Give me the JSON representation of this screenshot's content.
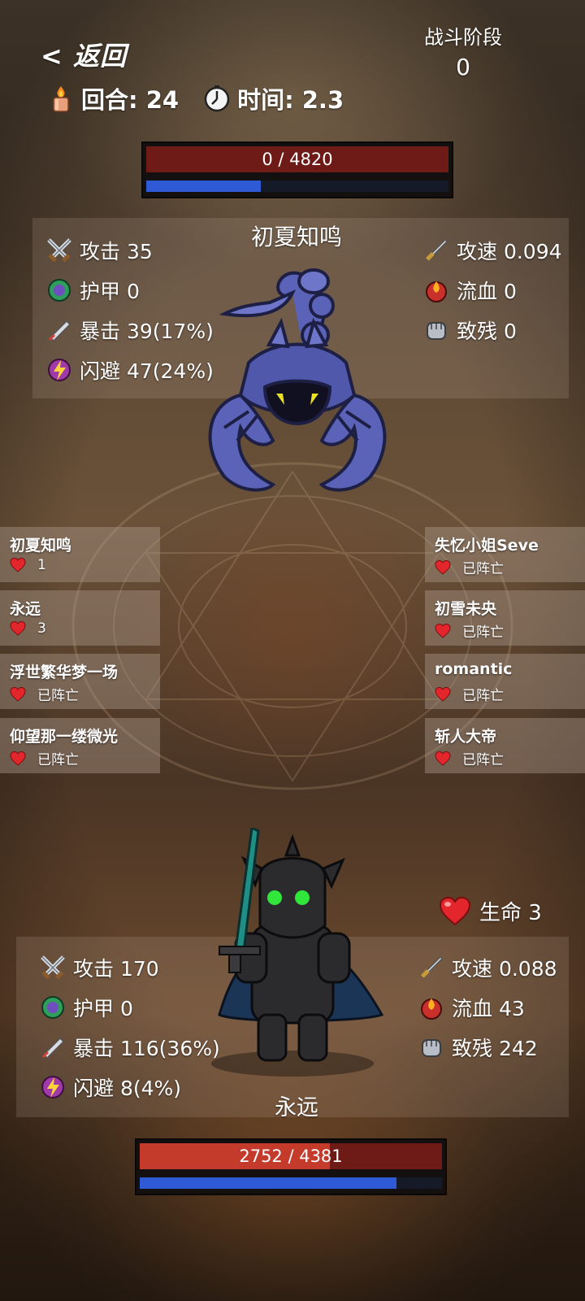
{
  "header": {
    "back_label": "< 返回",
    "phase_label": "战斗阶段",
    "phase_value": "0",
    "round_label": "回合: 24",
    "time_label": "时间: 2.3"
  },
  "enemy": {
    "name": "初夏知鸣",
    "hp_text": "0 / 4820",
    "hp_fraction": 0,
    "mp_fraction": 0.38,
    "stats_left": [
      {
        "icon": "crossed-swords-icon",
        "text": "攻击 35"
      },
      {
        "icon": "armor-icon",
        "text": "护甲 0"
      },
      {
        "icon": "critical-blade-icon",
        "text": "暴击 39(17%)"
      },
      {
        "icon": "dodge-icon",
        "text": "闪避 47(24%)"
      }
    ],
    "stats_right": [
      {
        "icon": "sword-icon",
        "text": "攻速 0.094"
      },
      {
        "icon": "bleed-icon",
        "text": "流血 0"
      },
      {
        "icon": "fist-icon",
        "text": "致残 0"
      }
    ]
  },
  "roster_left": [
    {
      "name": "初夏知鸣",
      "status": "1"
    },
    {
      "name": "永远",
      "status": "3"
    },
    {
      "name": "浮世繁华梦一场",
      "status": "已阵亡"
    },
    {
      "name": "仰望那一缕微光",
      "status": "已阵亡"
    }
  ],
  "roster_right": [
    {
      "name": "失忆小姐Seve",
      "status": "已阵亡"
    },
    {
      "name": "初雪未央",
      "status": "已阵亡"
    },
    {
      "name": "romantic",
      "status": "已阵亡"
    },
    {
      "name": "斩人大帝",
      "status": "已阵亡"
    }
  ],
  "player": {
    "name": "永远",
    "life_label": "生命 3",
    "hp_text": "2752 / 4381",
    "hp_fraction": 0.628,
    "mp_fraction": 0.85,
    "stats_left": [
      {
        "icon": "crossed-swords-icon",
        "text": "攻击 170"
      },
      {
        "icon": "armor-icon",
        "text": "护甲 0"
      },
      {
        "icon": "critical-blade-icon",
        "text": "暴击 116(36%)"
      },
      {
        "icon": "dodge-icon",
        "text": "闪避 8(4%)"
      }
    ],
    "stats_right": [
      {
        "icon": "sword-icon",
        "text": "攻速 0.088"
      },
      {
        "icon": "bleed-icon",
        "text": "流血 43"
      },
      {
        "icon": "fist-icon",
        "text": "致残 242"
      }
    ]
  },
  "colors": {
    "hp_red": "#c43a2b",
    "hp_dark": "#6e1b17",
    "mp_blue": "#2f5ad6",
    "heart_red": "#e3262c",
    "scorpion": "#5b63b8",
    "knight": "#2b2b2e",
    "sword_teal": "#1f8f86"
  }
}
